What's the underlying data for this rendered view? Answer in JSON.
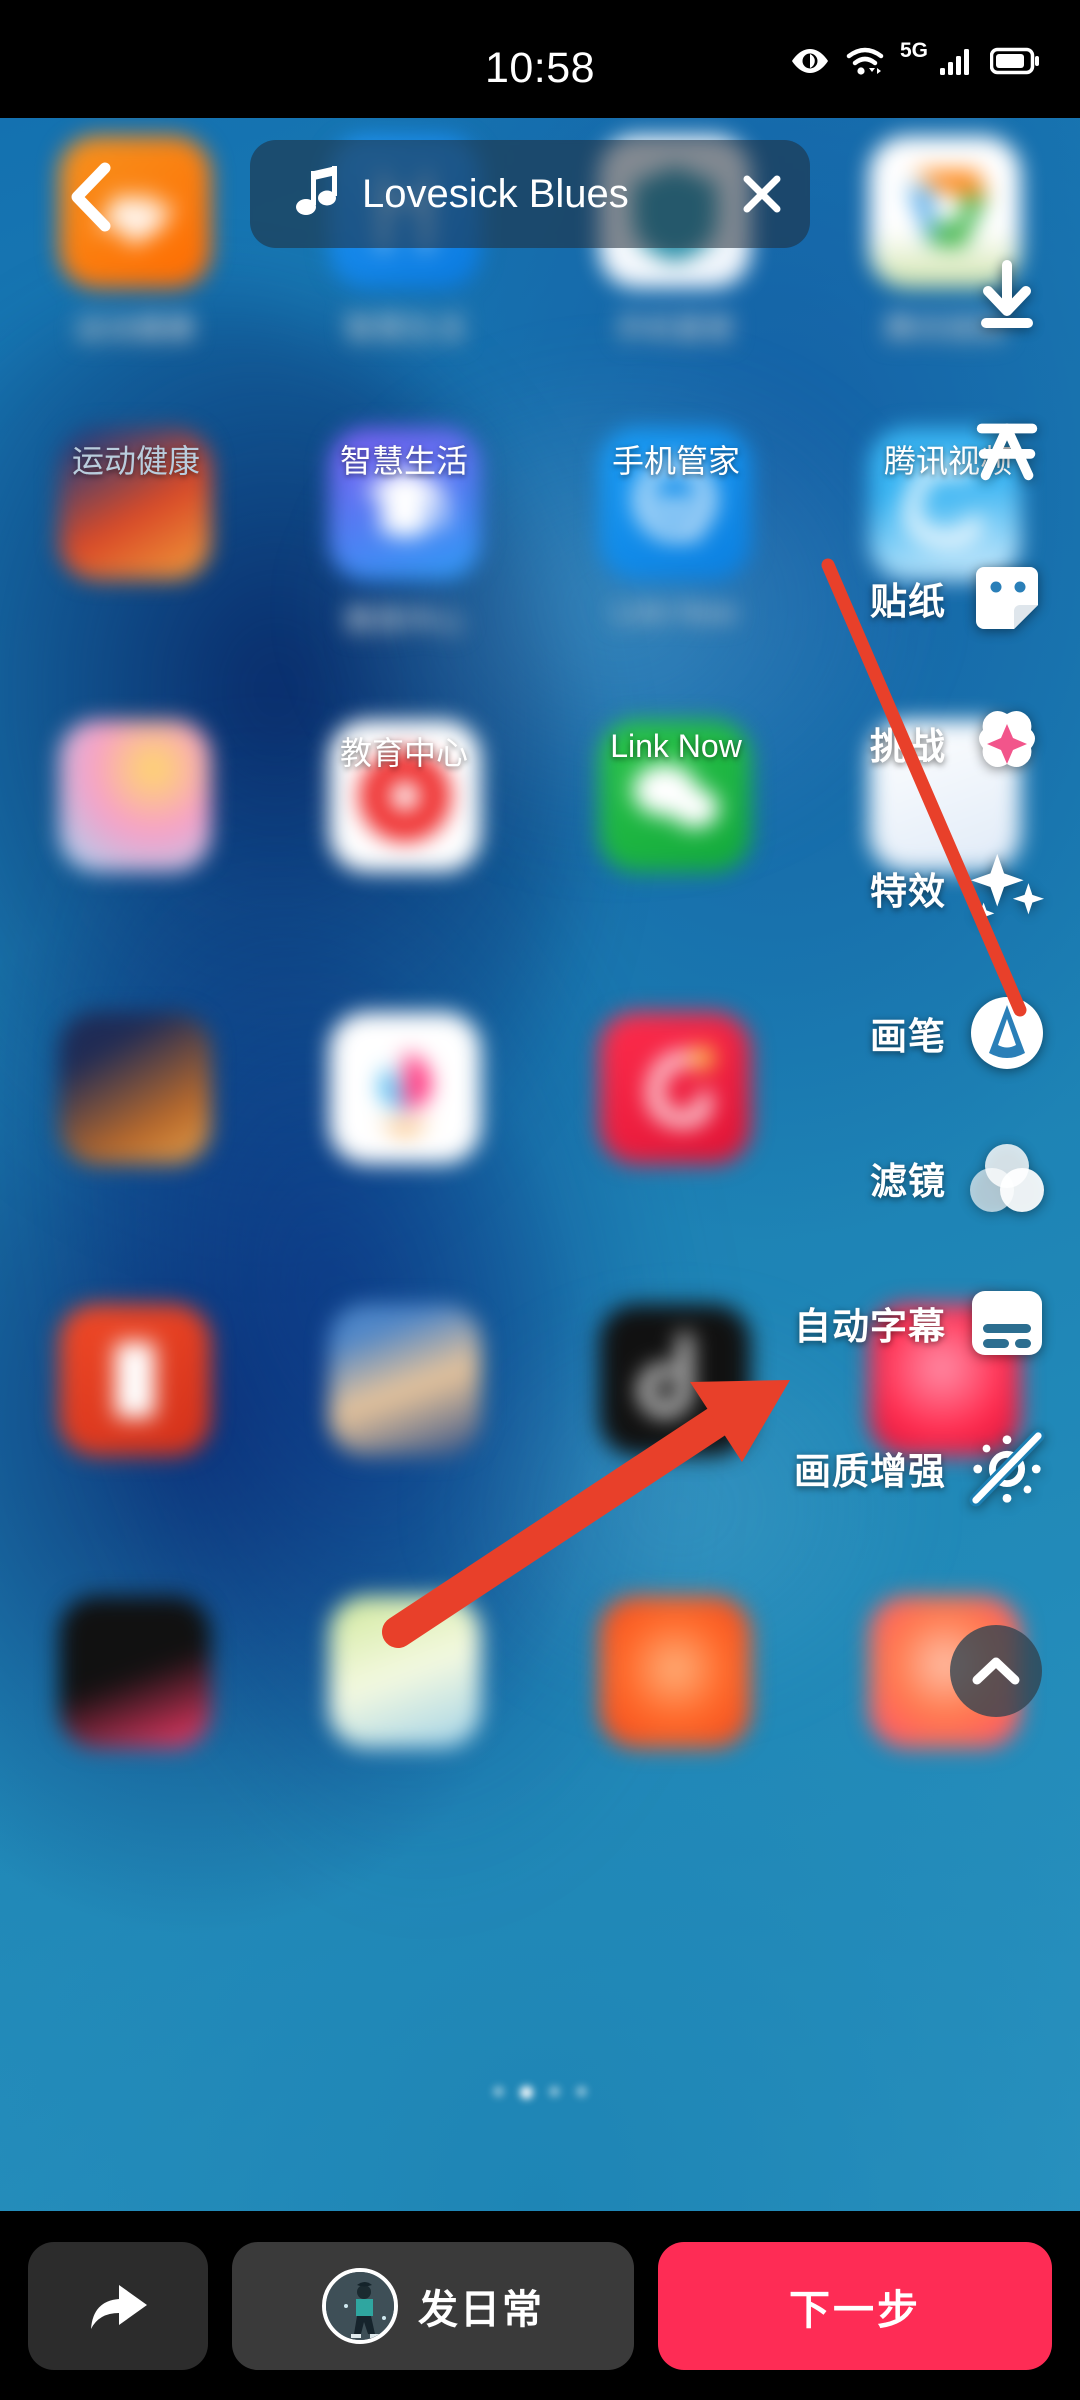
{
  "status_bar": {
    "time": "10:58",
    "network_label": "5G",
    "icons": [
      "eye-comfort-icon",
      "wifi-icon",
      "signal-bars-icon",
      "battery-icon"
    ]
  },
  "music_bar": {
    "icon": "music-note-icon",
    "title": "Lovesick Blues",
    "close_label": "×"
  },
  "nav": {
    "back_label": "back-chevron"
  },
  "toolbar": {
    "items": [
      {
        "label": "贴纸",
        "icon": "sticker-icon"
      },
      {
        "label": "挑战",
        "icon": "challenge-star-icon"
      },
      {
        "label": "特效",
        "icon": "effects-sparkle-icon"
      },
      {
        "label": "画笔",
        "icon": "brush-icon"
      },
      {
        "label": "滤镜",
        "icon": "filter-circles-icon"
      },
      {
        "label": "自动字幕",
        "icon": "auto-caption-icon"
      },
      {
        "label": "画质增强",
        "icon": "quality-enhance-off-icon"
      }
    ],
    "collapse_icon": "chevron-up-icon"
  },
  "bottom_bar": {
    "share_icon": "share-arrow-icon",
    "daily_label": "发日常",
    "daily_avatar": "walking-person-avatar",
    "next_label": "下一步",
    "next_color": "#fe2c55"
  },
  "home_screen": {
    "row1": [
      {
        "label": "运动健康",
        "color1": "#f7931e",
        "color2": "#ff6a00"
      },
      {
        "label": "智慧生活",
        "color1": "#2196f3",
        "color2": "#0a7ae0"
      },
      {
        "label": "手机管家",
        "color1": "#ffffff",
        "color2": "#eef4fb"
      },
      {
        "label": "腾讯视频",
        "color1": "#ffffff",
        "color2": "#eaf3e4"
      }
    ],
    "row2": [
      {
        "label": "",
        "color1": "#d94a28",
        "color2": "#2a3f7a"
      },
      {
        "label": "教育中心",
        "color1": "#7b5cf0",
        "color2": "#2e9bf5"
      },
      {
        "label": "Link Now",
        "color1": "#1a9cf5",
        "color2": "#0b7fe0"
      },
      {
        "label": "",
        "color1": "#39b4f2",
        "color2": "#7fd3f7"
      }
    ],
    "row3": [
      {
        "label": "",
        "color1": "#ffffff",
        "color2": "#f0e6f5"
      },
      {
        "label": "",
        "color1": "#ffffff",
        "color2": "#f7f7f7"
      },
      {
        "label": "",
        "color1": "#2bc44a",
        "color2": "#12a93a"
      },
      {
        "label": "",
        "color1": "#ffffff",
        "color2": "#e8eef6"
      }
    ],
    "row4": [
      {
        "label": "",
        "color1": "#1f2b55",
        "color2": "#b7692c"
      },
      {
        "label": "",
        "color1": "#ffffff",
        "color2": "#ffe9f2"
      },
      {
        "label": "",
        "color1": "#ff2e4d",
        "color2": "#e01234"
      },
      {
        "label": "",
        "color1": "#2d7fd6",
        "color2": "#1a5fae"
      }
    ],
    "row5": [
      {
        "label": "",
        "color1": "#f04a27",
        "color2": "#d2301a"
      },
      {
        "label": "",
        "color1": "#2f5f9e",
        "color2": "#173f74"
      },
      {
        "label": "",
        "color1": "#121212",
        "color2": "#000000"
      },
      {
        "label": "",
        "color1": "#ff2b4e",
        "color2": "#d01037"
      }
    ],
    "row6": [
      {
        "label": "",
        "color1": "#111111",
        "color2": "#23121a"
      },
      {
        "label": "",
        "color1": "#a8d44e",
        "color2": "#e9f3c5"
      },
      {
        "label": "",
        "color1": "#ff6a2b",
        "color2": "#ef4418"
      },
      {
        "label": "",
        "color1": "#ff7a4e",
        "color2": "#ff4d6d"
      }
    ]
  },
  "annotations": {
    "arrow_target": "自动字幕",
    "arrow_color": "#e8402a",
    "line_color": "#e8402a"
  }
}
